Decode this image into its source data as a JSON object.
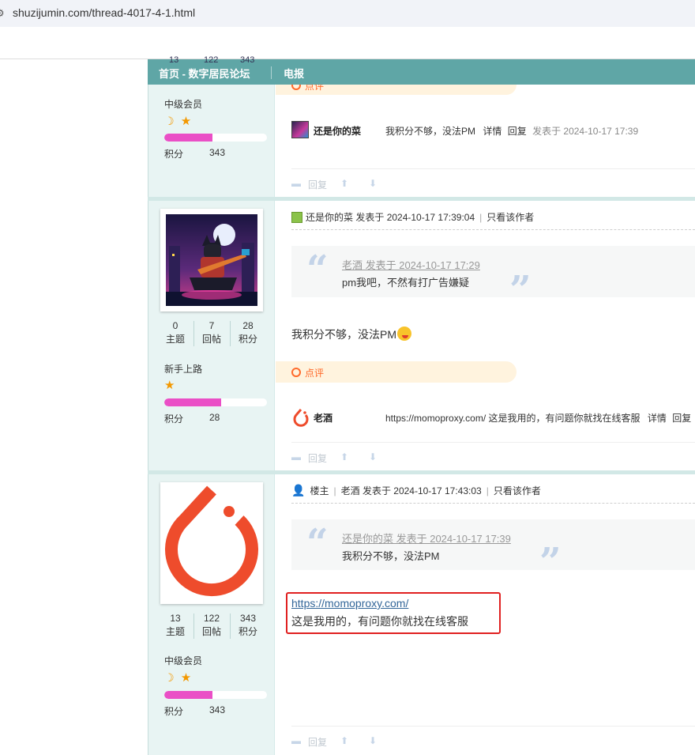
{
  "browser": {
    "url": "shuzijumin.com/thread-4017-4-1.html"
  },
  "navbar": {
    "home": "首页 - 数字居民论坛",
    "telegram": "电报"
  },
  "ghost_stats": [
    "13",
    "122",
    "343"
  ],
  "post1_user": {
    "rank": "中级会员",
    "credit_label": "积分",
    "credit_value": "343",
    "progress": 0.47
  },
  "post1_comments": {
    "dianping_label": "点评",
    "comment": {
      "name": "还是你的菜",
      "text": "我积分不够，没法PM",
      "detail": "详情",
      "reply": "回复",
      "time": "发表于 2024-10-17 17:39"
    },
    "actions": {
      "reply": "回复"
    }
  },
  "post2_user": {
    "stats": [
      {
        "value": "0",
        "label": "主题"
      },
      {
        "value": "7",
        "label": "回帖"
      },
      {
        "value": "28",
        "label": "积分"
      }
    ],
    "rank": "新手上路",
    "credit_label": "积分",
    "credit_value": "28",
    "progress": 0.55
  },
  "post2": {
    "author": "还是你的菜",
    "posted": "发表于 2024-10-17 17:39:04",
    "only_author": "只看该作者",
    "quote_src": "老酒 发表于 2024-10-17 17:29",
    "quote_body": "pm我吧，不然有打广告嫌疑",
    "body": "我积分不够，没法PM",
    "dianping_label": "点评",
    "comment": {
      "name": "老酒",
      "text": "https://momoproxy.com/ 这是我用的，有问题你就找在线客服",
      "detail": "详情",
      "reply": "回复"
    },
    "actions": {
      "reply": "回复"
    }
  },
  "post3_user": {
    "stats": [
      {
        "value": "13",
        "label": "主题"
      },
      {
        "value": "122",
        "label": "回帖"
      },
      {
        "value": "343",
        "label": "积分"
      }
    ],
    "rank": "中级会员",
    "credit_label": "积分",
    "credit_value": "343",
    "progress": 0.47
  },
  "post3": {
    "owner": "楼主",
    "author": "老酒",
    "posted": "发表于 2024-10-17 17:43:03",
    "only_author": "只看该作者",
    "quote_src": "还是你的菜 发表于 2024-10-17 17:39",
    "quote_body": "我积分不够，没法PM",
    "link": "https://momoproxy.com/",
    "body": "这是我用的，有问题你就找在线客服",
    "actions": {
      "reply": "回复"
    }
  },
  "colors": {
    "nav": "#5fa6a6",
    "sidebar": "#e8f4f3",
    "accent": "#ff6a2b",
    "progress": "#ea4fc6",
    "highlight": "#e02020"
  }
}
